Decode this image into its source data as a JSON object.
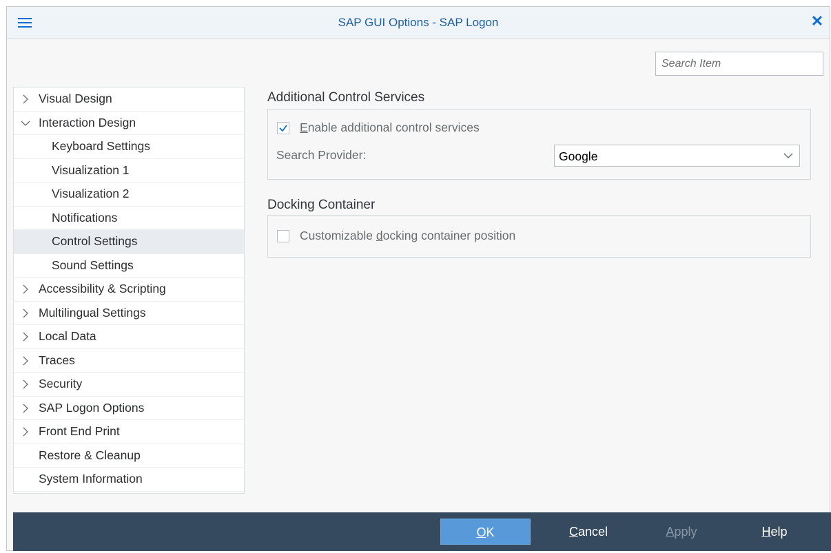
{
  "window": {
    "title": "SAP GUI Options - SAP Logon"
  },
  "icons": {
    "menu": "menu-icon",
    "close": "close-icon",
    "close_glyph": "✕",
    "expand_glyph": "›",
    "expanded_glyph": "⌄",
    "check_glyph": "✓"
  },
  "search": {
    "placeholder": "Search Item"
  },
  "tree": {
    "items": [
      {
        "label": "Visual Design",
        "arrow": ">",
        "level": 0
      },
      {
        "label": "Interaction Design",
        "arrow": "v",
        "level": 0
      },
      {
        "label": "Keyboard Settings",
        "arrow": "",
        "level": 1
      },
      {
        "label": "Visualization 1",
        "arrow": "",
        "level": 1
      },
      {
        "label": "Visualization 2",
        "arrow": "",
        "level": 1
      },
      {
        "label": "Notifications",
        "arrow": "",
        "level": 1
      },
      {
        "label": "Control Settings",
        "arrow": "",
        "level": 1,
        "selected": true
      },
      {
        "label": "Sound Settings",
        "arrow": "",
        "level": 1
      },
      {
        "label": "Accessibility & Scripting",
        "arrow": ">",
        "level": 0
      },
      {
        "label": "Multilingual Settings",
        "arrow": ">",
        "level": 0
      },
      {
        "label": "Local Data",
        "arrow": ">",
        "level": 0
      },
      {
        "label": "Traces",
        "arrow": ">",
        "level": 0
      },
      {
        "label": "Security",
        "arrow": ">",
        "level": 0
      },
      {
        "label": "SAP Logon Options",
        "arrow": ">",
        "level": 0
      },
      {
        "label": "Front End Print",
        "arrow": ">",
        "level": 0
      },
      {
        "label": "Restore & Cleanup",
        "arrow": "",
        "level": 0
      },
      {
        "label": "System Information",
        "arrow": "",
        "level": 0
      }
    ]
  },
  "additional_control_services": {
    "heading": "Additional Control Services",
    "enable_checkbox": {
      "checked": true,
      "mnemonic": "E",
      "label_rest": "nable additional control services"
    },
    "search_provider": {
      "label": "Search Provider:",
      "value": "Google"
    }
  },
  "docking_container": {
    "heading": "Docking Container",
    "position_checkbox": {
      "checked": false,
      "label_pre": "Customizable ",
      "mnemonic": "d",
      "label_post": "ocking container position"
    }
  },
  "footer": {
    "ok": {
      "mnemonic": "O",
      "rest": "K"
    },
    "cancel": {
      "mnemonic": "C",
      "rest": "ancel"
    },
    "apply": {
      "mnemonic": "A",
      "rest": "pply",
      "disabled": true
    },
    "help": {
      "mnemonic": "H",
      "rest": "elp"
    }
  },
  "colors": {
    "accent": "#0a6ed1",
    "footer_bg": "#354a5f",
    "ok_button": "#5899da",
    "selected_row": "#e8ebef"
  }
}
